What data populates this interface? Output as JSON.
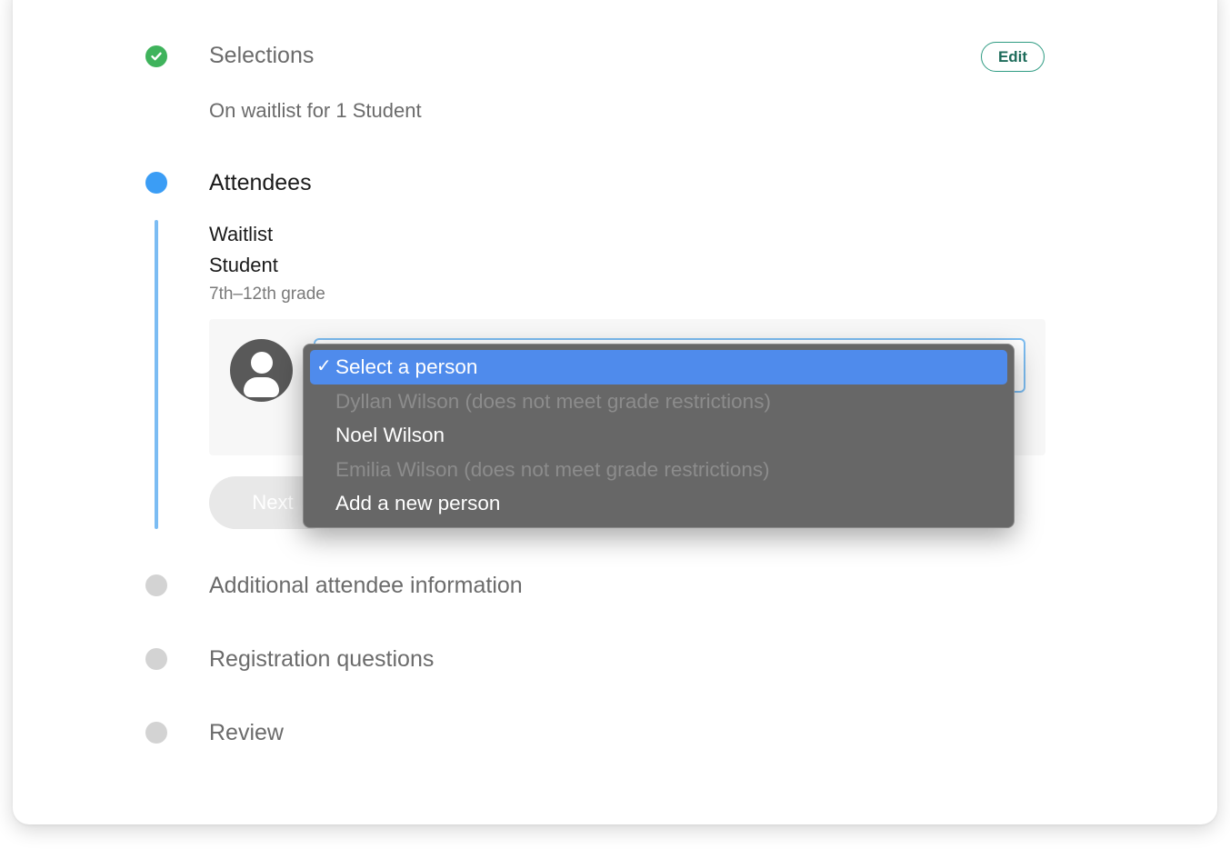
{
  "steps": {
    "selections": {
      "title": "Selections",
      "summary": "On waitlist for 1 Student",
      "edit_label": "Edit"
    },
    "attendees": {
      "title": "Attendees",
      "waitlist_label": "Waitlist",
      "role_label": "Student",
      "grade_label": "7th–12th grade",
      "next_label": "Next"
    },
    "additional_info": {
      "title": "Additional attendee information"
    },
    "registration_questions": {
      "title": "Registration questions"
    },
    "review": {
      "title": "Review"
    }
  },
  "person_select": {
    "selected": "Select a person",
    "options": [
      {
        "label": "Select a person",
        "state": "selected"
      },
      {
        "label": "Dyllan Wilson (does not meet grade restrictions)",
        "state": "disabled"
      },
      {
        "label": "Noel Wilson",
        "state": "enabled"
      },
      {
        "label": "Emilia Wilson (does not meet grade restrictions)",
        "state": "disabled"
      },
      {
        "label": "Add a new person",
        "state": "enabled"
      }
    ],
    "check_mark": "✓"
  },
  "colors": {
    "complete": "#3fb35c",
    "active": "#3b9df5",
    "pending": "#d3d3d3",
    "accent": "#2e9b82",
    "menu_highlight": "#4f8bec"
  },
  "icons": {
    "complete_step": "check-circle-icon",
    "avatar": "person-avatar-icon"
  }
}
